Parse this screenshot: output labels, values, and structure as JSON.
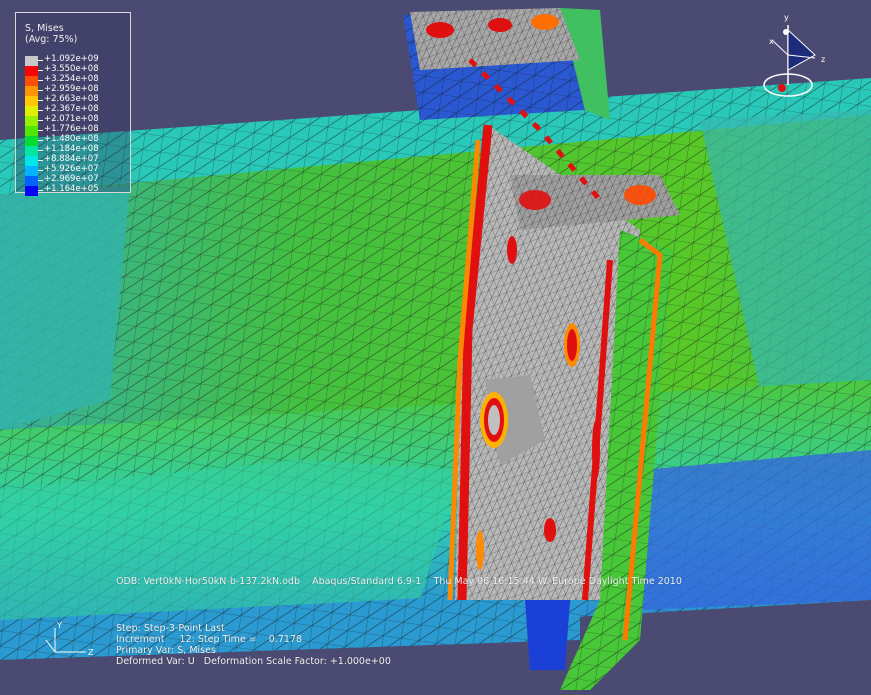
{
  "legend": {
    "title": "S, Mises",
    "averaging": "(Avg: 75%)",
    "entries": [
      {
        "label": "+1.092e+09",
        "color": "#c8c8c8"
      },
      {
        "label": "+3.550e+08",
        "color": "#ff0000"
      },
      {
        "label": "+3.254e+08",
        "color": "#ff5000"
      },
      {
        "label": "+2.959e+08",
        "color": "#ff9600"
      },
      {
        "label": "+2.663e+08",
        "color": "#ffc800"
      },
      {
        "label": "+2.367e+08",
        "color": "#e0f000"
      },
      {
        "label": "+2.071e+08",
        "color": "#96f000"
      },
      {
        "label": "+1.776e+08",
        "color": "#50e600"
      },
      {
        "label": "+1.480e+08",
        "color": "#00dc32"
      },
      {
        "label": "+1.184e+08",
        "color": "#00e6a0"
      },
      {
        "label": "+8.884e+07",
        "color": "#00e6e6"
      },
      {
        "label": "+5.926e+07",
        "color": "#00b4ff"
      },
      {
        "label": "+2.969e+07",
        "color": "#0064ff"
      },
      {
        "label": "+1.164e+05",
        "color": "#0000ff"
      }
    ]
  },
  "info": {
    "odb": "ODB: Vert0kN-Hor50kN-b-137.2kN.odb    Abaqus/Standard 6.9-1    Thu May 06 16:15:44 W. Europe Daylight Time 2010",
    "step": "Step: Step-3-Point Last",
    "increment": "Increment     12: Step Time =    0.7178",
    "primary_var": "Primary Var: S, Mises",
    "deformed_var": "Deformed Var: U   Deformation Scale Factor: +1.000e+00"
  },
  "triad": {
    "x": "x",
    "y": "y",
    "z": "z"
  },
  "mini_triad": {
    "y": "Y",
    "z": "Z"
  },
  "colors": {
    "background": "#4a4a72",
    "mesh_line": "#1a1a1a",
    "plate_grey": "#b4b4b4",
    "green": "#50c830",
    "cyan": "#30d8b8",
    "blue": "#3c78e6",
    "red": "#e01010"
  }
}
